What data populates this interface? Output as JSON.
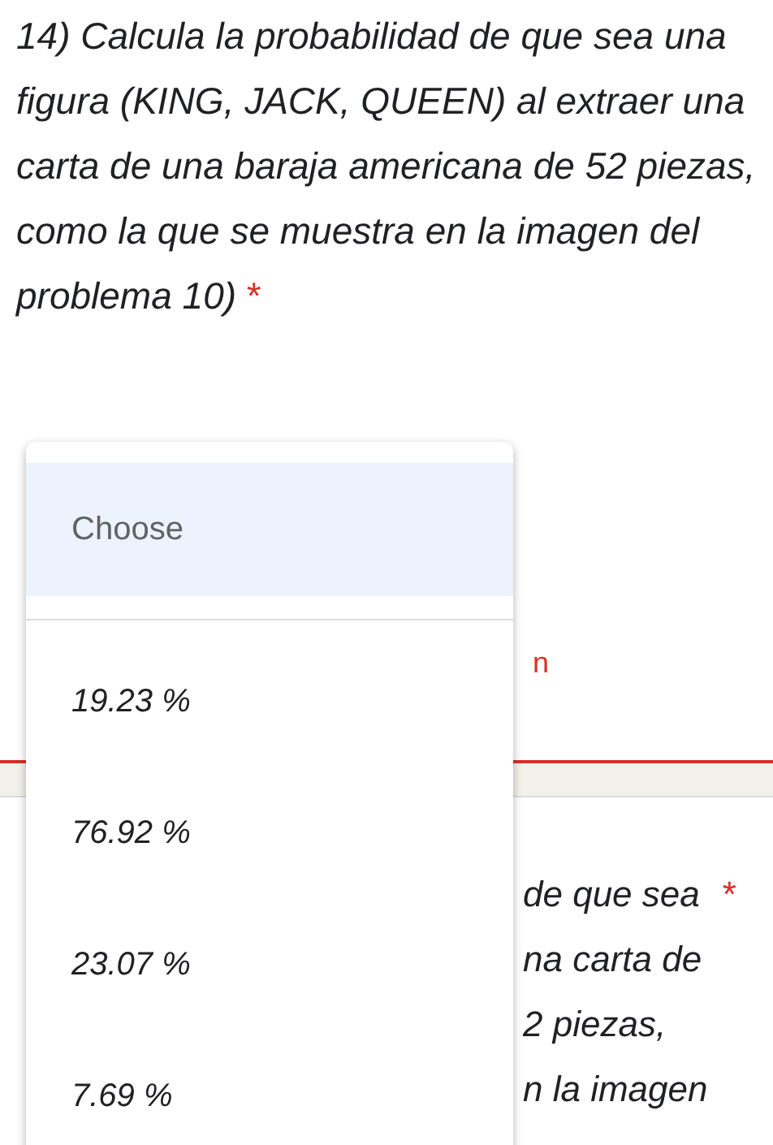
{
  "question": {
    "text": "14) Calcula la probabilidad de que sea una figura (KING, JACK, QUEEN) al extraer una carta de una baraja americana de 52 piezas, como la que se muestra en la imagen del problema 10)",
    "required_mark": "*"
  },
  "error_fragment": "n",
  "next_question": {
    "lines": [
      "de que sea",
      "na carta de",
      "2 piezas,",
      "n la imagen"
    ],
    "required_mark": "*"
  },
  "dropdown": {
    "options": [
      {
        "kind": "placeholder",
        "label": "Choose",
        "selected": true
      },
      {
        "kind": "answer",
        "label": "19.23 %",
        "selected": false
      },
      {
        "kind": "answer",
        "label": "76.92 %",
        "selected": false
      },
      {
        "kind": "answer",
        "label": "23.07 %",
        "selected": false
      },
      {
        "kind": "answer",
        "label": "7.69 %",
        "selected": false
      }
    ]
  }
}
